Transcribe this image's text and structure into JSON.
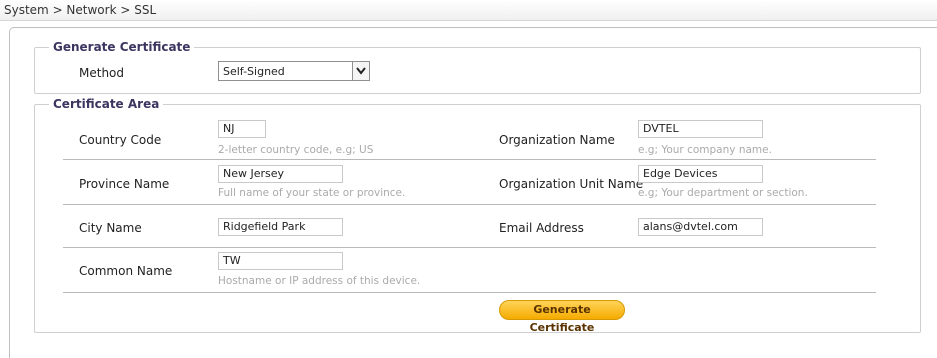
{
  "breadcrumb": {
    "text": "System > Network > SSL"
  },
  "generate_section": {
    "legend": "Generate Certificate",
    "method_label": "Method",
    "method_value": "Self-Signed"
  },
  "certificate_area": {
    "legend": "Certificate Area",
    "country_code": {
      "label": "Country Code",
      "value": "NJ",
      "hint": "2-letter country code, e.g; US"
    },
    "province_name": {
      "label": "Province Name",
      "value": "New Jersey",
      "hint": "Full name of your state or province."
    },
    "city_name": {
      "label": "City Name",
      "value": "Ridgefield Park"
    },
    "common_name": {
      "label": "Common Name",
      "value": "TW",
      "hint": "Hostname or IP address of this device."
    },
    "organization_name": {
      "label": "Organization Name",
      "value": "DVTEL",
      "hint": "e.g; Your company name."
    },
    "organization_unit_name": {
      "label": "Organization Unit Name",
      "value": "Edge Devices",
      "hint": "e.g; Your department or section."
    },
    "email_address": {
      "label": "Email Address",
      "value": "alans@dvtel.com"
    }
  },
  "actions": {
    "generate_button": "Generate Certificate"
  },
  "colors": {
    "accent_legend": "#3d3560",
    "button_top": "#ffd35a",
    "button_bottom": "#f5ab00"
  },
  "icons": {
    "select_arrow": "chevron-down-icon"
  }
}
